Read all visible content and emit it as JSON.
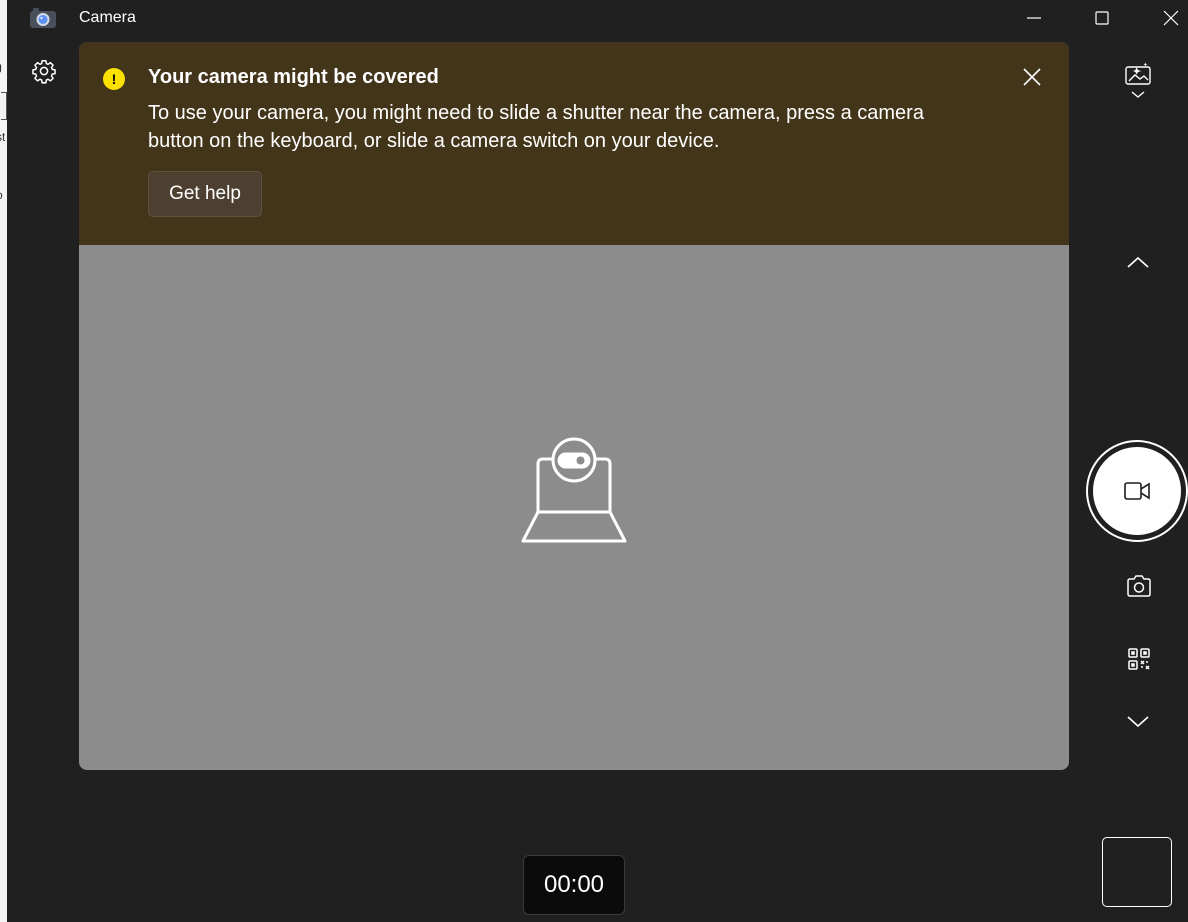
{
  "window": {
    "title": "Camera",
    "icons": {
      "app": "camera-app-icon",
      "minimize": "minimize-icon",
      "maximize": "maximize-icon",
      "close": "close-icon"
    }
  },
  "background_window": {
    "fragments": [
      "J",
      "st",
      "-",
      "o"
    ]
  },
  "settings": {
    "icon": "gear-icon"
  },
  "banner": {
    "title": "Your camera might be covered",
    "message": "To use your camera, you might need to slide a shutter near the camera, press a camera button on the keyboard, or slide a camera switch on your device.",
    "help_button": "Get help",
    "warning_glyph": "!",
    "background_color": "#433519",
    "warning_color": "#fce100"
  },
  "preview": {
    "state_icon": "camera-covered-icon",
    "background_color": "#8c8c8d"
  },
  "timer": {
    "value": "00:00"
  },
  "rail": {
    "effects_icon": "sparkle-image-icon",
    "effects_expand_icon": "chevron-down-icon",
    "collapse_icon": "chevron-up-icon",
    "capture_mode_icon": "video-camera-icon",
    "photo_mode_icon": "photo-camera-icon",
    "scan_mode_icon": "qr-code-icon",
    "more_modes_icon": "chevron-down-icon",
    "gallery_icon": "gallery-thumbnail"
  }
}
